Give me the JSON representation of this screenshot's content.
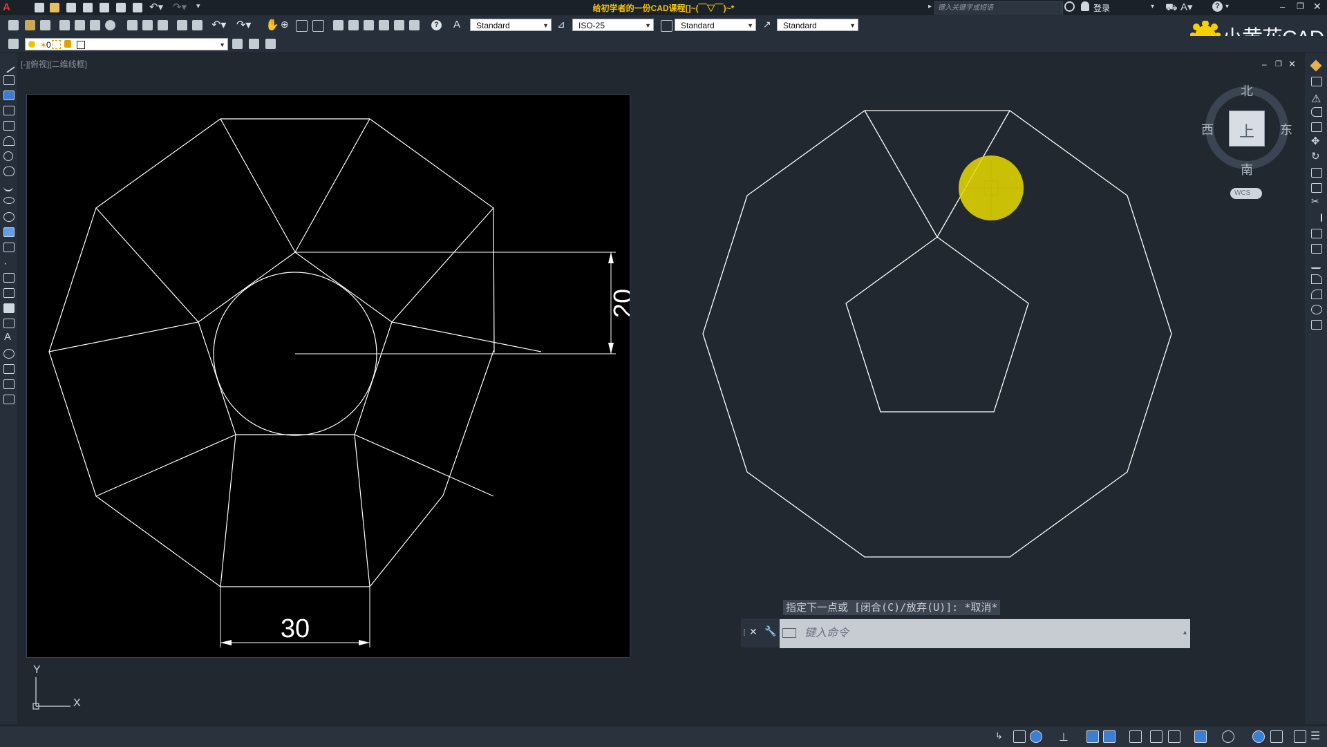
{
  "window": {
    "title": "给初学者的一份CAD课程[]~(￣▽￣)~*",
    "search_placeholder": "键入关键字或短语",
    "login_label": "登录"
  },
  "toolbar": {
    "text_style": "Standard",
    "dim_style": "ISO-25",
    "table_style": "Standard",
    "multileader_style": "Standard",
    "layer_name": "0"
  },
  "logo": {
    "text": "小黄花CAD"
  },
  "viewport": {
    "label": "[-][俯视][二维线框]"
  },
  "drawing": {
    "dim_vertical": "20",
    "dim_horizontal": "30"
  },
  "viewcube": {
    "north": "北",
    "south": "南",
    "east": "东",
    "west": "西",
    "face": "上",
    "wcs": "WCS"
  },
  "ucs": {
    "x": "X",
    "y": "Y"
  },
  "command": {
    "history": "指定下一点或 [闭合(C)/放弃(U)]: *取消*",
    "placeholder": "键入命令"
  },
  "colors": {
    "background": "#212830",
    "viewport_black": "#000000",
    "highlight_yellow": "#f0e000",
    "title_gold": "#f5c400"
  }
}
